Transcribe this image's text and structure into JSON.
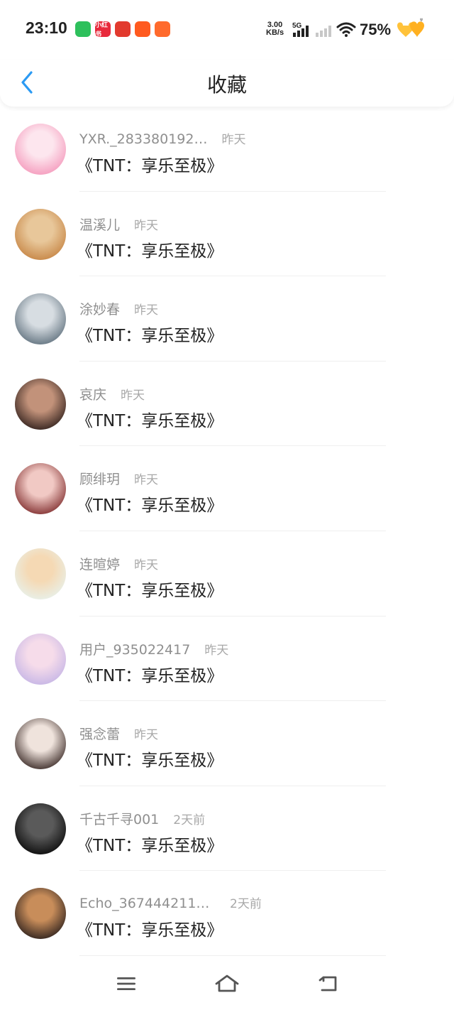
{
  "status_bar": {
    "time": "23:10",
    "net_speed_value": "3.00",
    "net_speed_unit": "KB/s",
    "network_type": "5G",
    "battery_percent": "75%",
    "app_icons": [
      {
        "icon": "wechat-icon",
        "color": "#2ec05c",
        "label": ""
      },
      {
        "icon": "xiaohongshu-icon",
        "color": "#e8293b",
        "label": "小红书"
      },
      {
        "icon": "pinduoduo-icon",
        "color": "#e23a2e",
        "label": ""
      },
      {
        "icon": "taobao-icon",
        "color": "#ff5a1f",
        "label": ""
      },
      {
        "icon": "app-icon",
        "color": "#ff6a2c",
        "label": ""
      }
    ]
  },
  "header": {
    "title": "收藏"
  },
  "items": [
    {
      "username": "YXR._283380192…",
      "time": "昨天",
      "content": "《TNT：享乐至极》",
      "avatar_color_a": "#f5a0c0",
      "avatar_color_b": "#fde6ee"
    },
    {
      "username": "温溪儿",
      "time": "昨天",
      "content": "《TNT：享乐至极》",
      "avatar_color_a": "#c98a4b",
      "avatar_color_b": "#e8c79a"
    },
    {
      "username": "涂妙春",
      "time": "昨天",
      "content": "《TNT：享乐至极》",
      "avatar_color_a": "#6a7a86",
      "avatar_color_b": "#d7dde2"
    },
    {
      "username": "哀庆",
      "time": "昨天",
      "content": "《TNT：享乐至极》",
      "avatar_color_a": "#3d2a24",
      "avatar_color_b": "#c2927a"
    },
    {
      "username": "顾绯玥",
      "time": "昨天",
      "content": "《TNT：享乐至极》",
      "avatar_color_a": "#8a3b3b",
      "avatar_color_b": "#f1c9c4"
    },
    {
      "username": "连暄婷",
      "time": "昨天",
      "content": "《TNT：享乐至极》",
      "avatar_color_a": "#e9efe6",
      "avatar_color_b": "#f5d9b4"
    },
    {
      "username": "用户_935022417",
      "time": "昨天",
      "content": "《TNT：享乐至极》",
      "avatar_color_a": "#c9b8e6",
      "avatar_color_b": "#f6dcea"
    },
    {
      "username": "强念蕾",
      "time": "昨天",
      "content": "《TNT：享乐至极》",
      "avatar_color_a": "#4a3a36",
      "avatar_color_b": "#efe3dc"
    },
    {
      "username": "千古千寻001",
      "time": "2天前",
      "content": "《TNT：享乐至极》",
      "avatar_color_a": "#111111",
      "avatar_color_b": "#5a5a5a"
    },
    {
      "username": "Echo_3674442116…",
      "time": "2天前",
      "content": "《TNT：享乐至极》",
      "avatar_color_a": "#3a2a22",
      "avatar_color_b": "#c88d5a"
    }
  ],
  "nav": {
    "menu_icon": "menu-icon",
    "home_icon": "home-icon",
    "back_icon": "back-icon"
  }
}
